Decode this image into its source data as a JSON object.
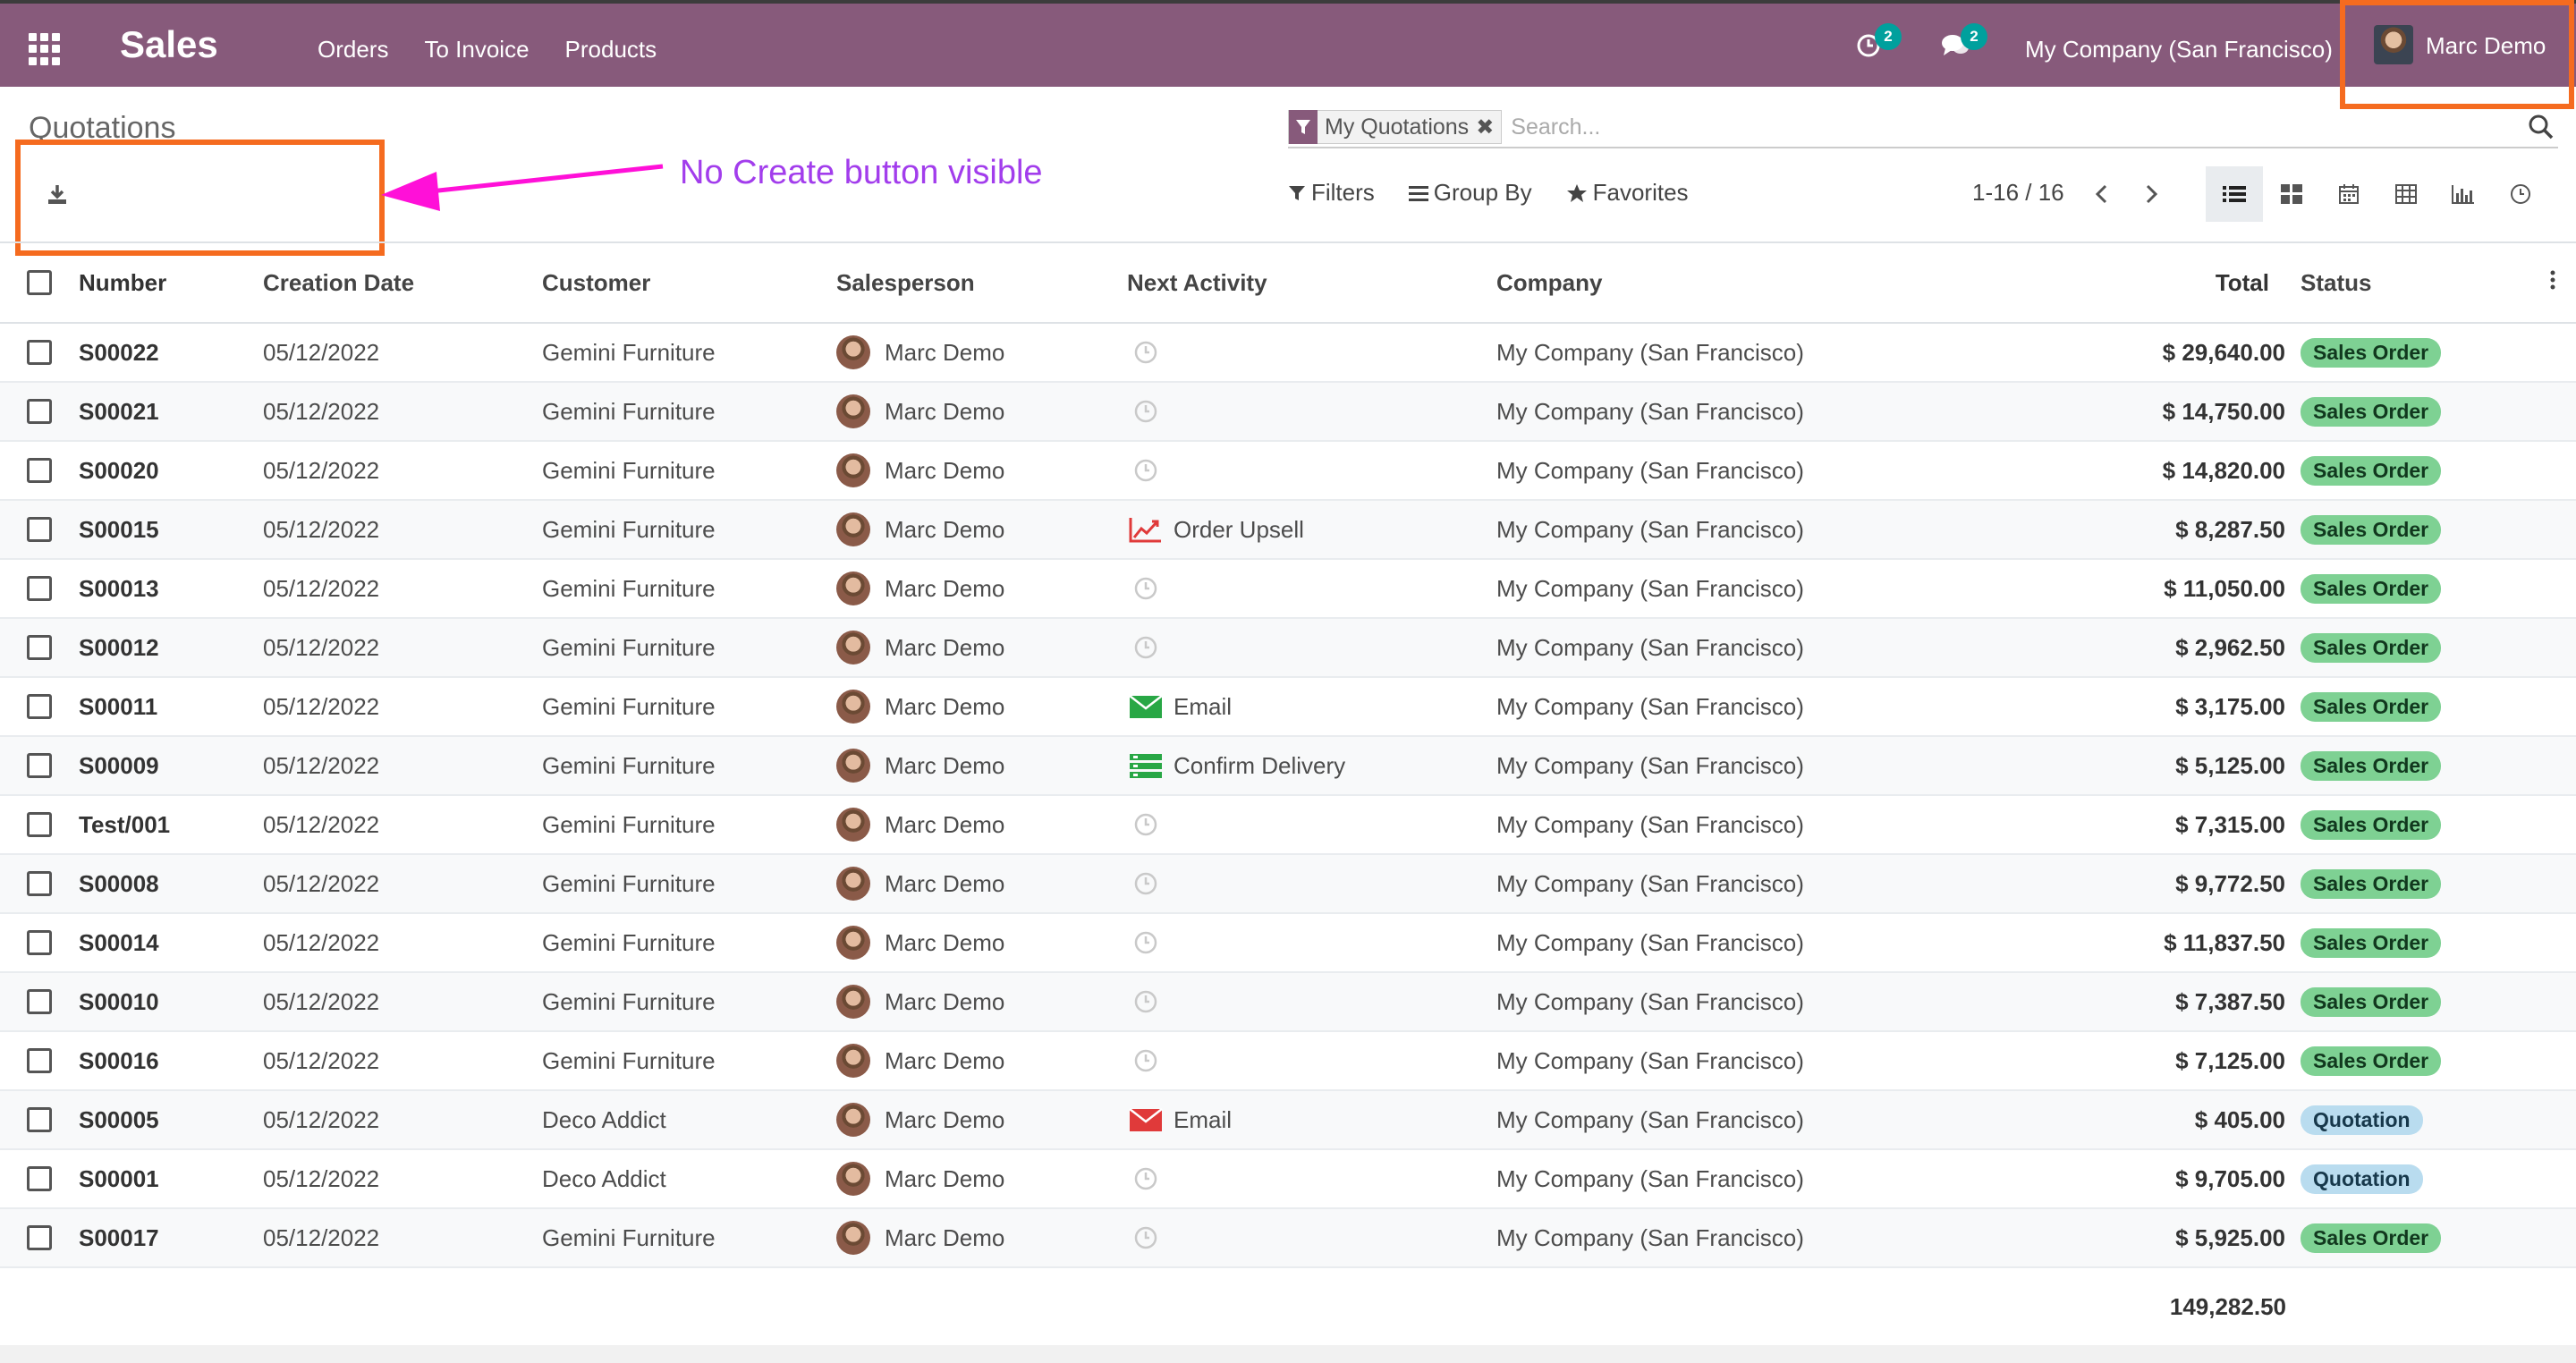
{
  "navbar": {
    "app_title": "Sales",
    "menu": [
      "Orders",
      "To Invoice",
      "Products"
    ],
    "activity_count": "2",
    "message_count": "2",
    "company": "My Company (San Francisco)",
    "user": "Marc Demo"
  },
  "control_panel": {
    "breadcrumb": "Quotations",
    "annotation": "No Create button visible",
    "facet": "My Quotations",
    "search_placeholder": "Search...",
    "filters_label": "Filters",
    "group_by_label": "Group By",
    "favorites_label": "Favorites",
    "pager": "1-16 / 16"
  },
  "table": {
    "headers": {
      "number": "Number",
      "date": "Creation Date",
      "customer": "Customer",
      "salesperson": "Salesperson",
      "activity": "Next Activity",
      "company": "Company",
      "total": "Total",
      "status": "Status"
    },
    "rows": [
      {
        "number": "S00022",
        "date": "05/12/2022",
        "customer": "Gemini Furniture",
        "salesperson": "Marc Demo",
        "activity": "",
        "activity_icon": "clock",
        "company": "My Company (San Francisco)",
        "total": "$ 29,640.00",
        "status": "Sales Order"
      },
      {
        "number": "S00021",
        "date": "05/12/2022",
        "customer": "Gemini Furniture",
        "salesperson": "Marc Demo",
        "activity": "",
        "activity_icon": "clock",
        "company": "My Company (San Francisco)",
        "total": "$ 14,750.00",
        "status": "Sales Order"
      },
      {
        "number": "S00020",
        "date": "05/12/2022",
        "customer": "Gemini Furniture",
        "salesperson": "Marc Demo",
        "activity": "",
        "activity_icon": "clock",
        "company": "My Company (San Francisco)",
        "total": "$ 14,820.00",
        "status": "Sales Order"
      },
      {
        "number": "S00015",
        "date": "05/12/2022",
        "customer": "Gemini Furniture",
        "salesperson": "Marc Demo",
        "activity": "Order Upsell",
        "activity_icon": "upsell",
        "company": "My Company (San Francisco)",
        "total": "$ 8,287.50",
        "status": "Sales Order"
      },
      {
        "number": "S00013",
        "date": "05/12/2022",
        "customer": "Gemini Furniture",
        "salesperson": "Marc Demo",
        "activity": "",
        "activity_icon": "clock",
        "company": "My Company (San Francisco)",
        "total": "$ 11,050.00",
        "status": "Sales Order"
      },
      {
        "number": "S00012",
        "date": "05/12/2022",
        "customer": "Gemini Furniture",
        "salesperson": "Marc Demo",
        "activity": "",
        "activity_icon": "clock",
        "company": "My Company (San Francisco)",
        "total": "$ 2,962.50",
        "status": "Sales Order"
      },
      {
        "number": "S00011",
        "date": "05/12/2022",
        "customer": "Gemini Furniture",
        "salesperson": "Marc Demo",
        "activity": "Email",
        "activity_icon": "email-green",
        "company": "My Company (San Francisco)",
        "total": "$ 3,175.00",
        "status": "Sales Order"
      },
      {
        "number": "S00009",
        "date": "05/12/2022",
        "customer": "Gemini Furniture",
        "salesperson": "Marc Demo",
        "activity": "Confirm Delivery",
        "activity_icon": "tasks",
        "company": "My Company (San Francisco)",
        "total": "$ 5,125.00",
        "status": "Sales Order"
      },
      {
        "number": "Test/001",
        "date": "05/12/2022",
        "customer": "Gemini Furniture",
        "salesperson": "Marc Demo",
        "activity": "",
        "activity_icon": "clock",
        "company": "My Company (San Francisco)",
        "total": "$ 7,315.00",
        "status": "Sales Order"
      },
      {
        "number": "S00008",
        "date": "05/12/2022",
        "customer": "Gemini Furniture",
        "salesperson": "Marc Demo",
        "activity": "",
        "activity_icon": "clock",
        "company": "My Company (San Francisco)",
        "total": "$ 9,772.50",
        "status": "Sales Order"
      },
      {
        "number": "S00014",
        "date": "05/12/2022",
        "customer": "Gemini Furniture",
        "salesperson": "Marc Demo",
        "activity": "",
        "activity_icon": "clock",
        "company": "My Company (San Francisco)",
        "total": "$ 11,837.50",
        "status": "Sales Order"
      },
      {
        "number": "S00010",
        "date": "05/12/2022",
        "customer": "Gemini Furniture",
        "salesperson": "Marc Demo",
        "activity": "",
        "activity_icon": "clock",
        "company": "My Company (San Francisco)",
        "total": "$ 7,387.50",
        "status": "Sales Order"
      },
      {
        "number": "S00016",
        "date": "05/12/2022",
        "customer": "Gemini Furniture",
        "salesperson": "Marc Demo",
        "activity": "",
        "activity_icon": "clock",
        "company": "My Company (San Francisco)",
        "total": "$ 7,125.00",
        "status": "Sales Order"
      },
      {
        "number": "S00005",
        "date": "05/12/2022",
        "customer": "Deco Addict",
        "salesperson": "Marc Demo",
        "activity": "Email",
        "activity_icon": "email-red",
        "company": "My Company (San Francisco)",
        "total": "$ 405.00",
        "status": "Quotation"
      },
      {
        "number": "S00001",
        "date": "05/12/2022",
        "customer": "Deco Addict",
        "salesperson": "Marc Demo",
        "activity": "",
        "activity_icon": "clock",
        "company": "My Company (San Francisco)",
        "total": "$ 9,705.00",
        "status": "Quotation"
      },
      {
        "number": "S00017",
        "date": "05/12/2022",
        "customer": "Gemini Furniture",
        "salesperson": "Marc Demo",
        "activity": "",
        "activity_icon": "clock",
        "company": "My Company (San Francisco)",
        "total": "$ 5,925.00",
        "status": "Sales Order"
      }
    ],
    "grand_total": "149,282.50"
  },
  "colors": {
    "navbar": "#875a7b",
    "annotation_box": "#f56b1f",
    "annotation_text": "#a23dec",
    "arrow": "#ff10d8",
    "badge": "#00a09d",
    "status_sale": "#7ed193",
    "status_quote": "#b9dcef"
  }
}
